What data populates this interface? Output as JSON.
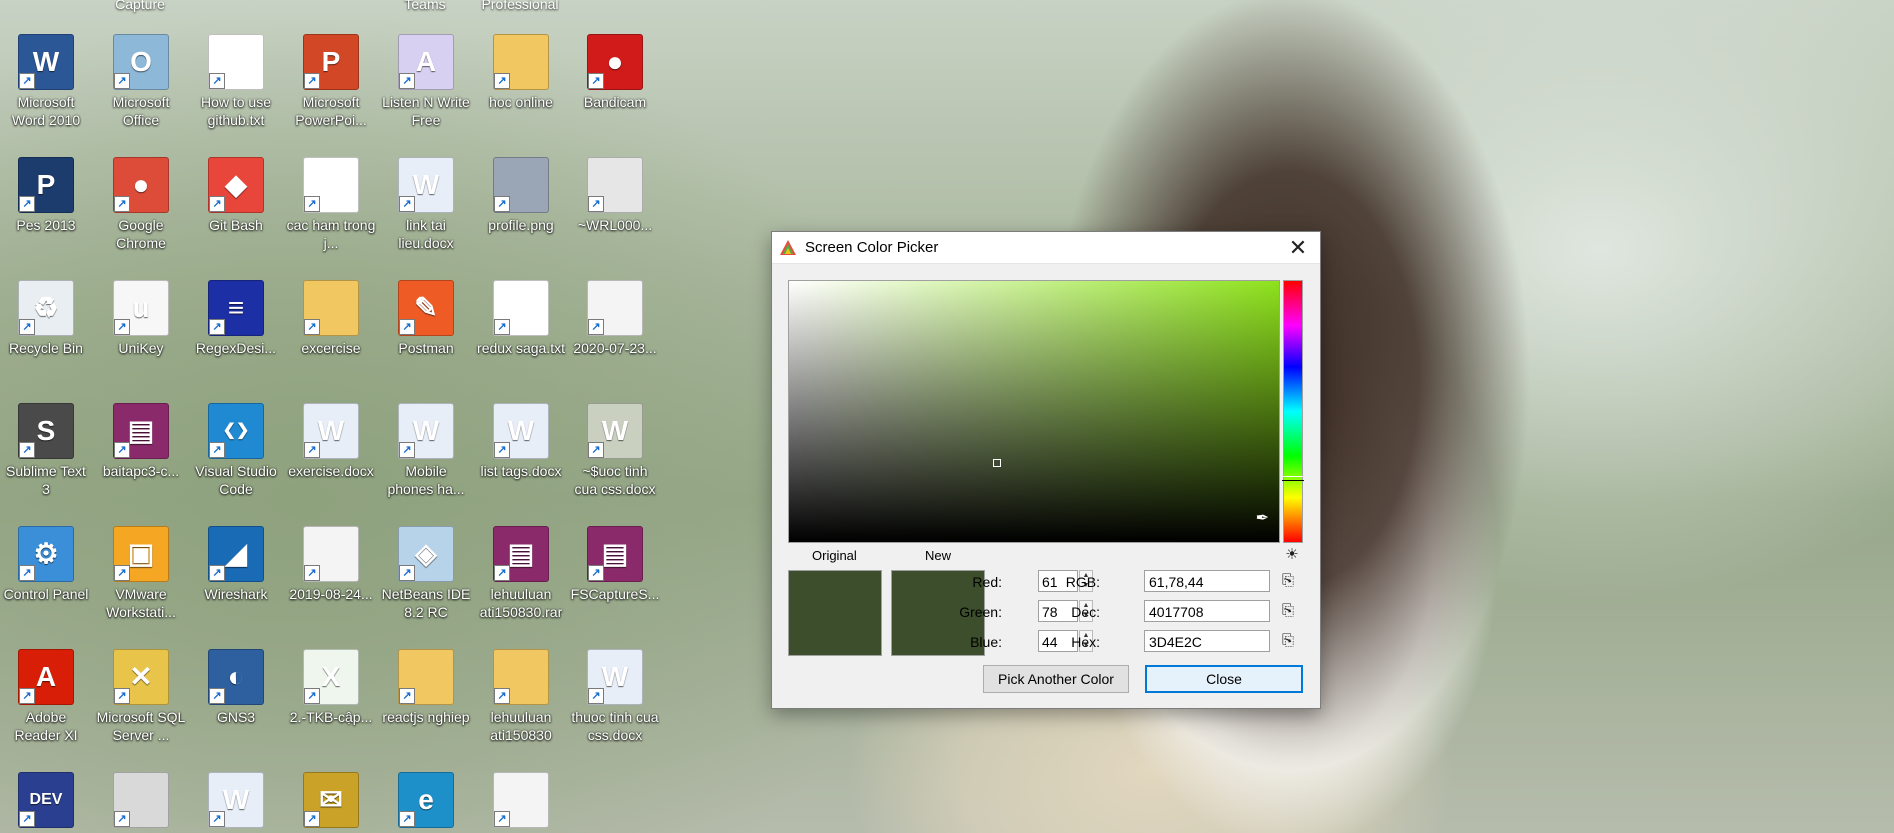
{
  "desktop": {
    "top_partial_labels": [
      "Capture",
      "Teams",
      "Professional"
    ],
    "icons": [
      {
        "label": "Microsoft Word 2010",
        "icon": "word-icon",
        "color": "#2b5797",
        "glyph": "W"
      },
      {
        "label": "Microsoft Office",
        "icon": "office-icon",
        "color": "#8db8d8",
        "glyph": "O"
      },
      {
        "label": "How to use github.txt",
        "icon": "text-file-icon",
        "color": "#ffffff",
        "glyph": ""
      },
      {
        "label": "Microsoft PowerPoi...",
        "icon": "powerpoint-icon",
        "color": "#d24726",
        "glyph": "P"
      },
      {
        "label": "Listen N Write Free",
        "icon": "listen-n-write-icon",
        "color": "#d8d0f0",
        "glyph": "A"
      },
      {
        "label": "hoc online",
        "icon": "folder-icon",
        "color": "#f1c761",
        "glyph": ""
      },
      {
        "label": "Bandicam",
        "icon": "bandicam-icon",
        "color": "#d11a1a",
        "glyph": "●"
      },
      {
        "label": "Pes 2013",
        "icon": "pes-icon",
        "color": "#1c3c6e",
        "glyph": "P"
      },
      {
        "label": "Google Chrome",
        "icon": "chrome-icon",
        "color": "#dd4b39",
        "glyph": "●"
      },
      {
        "label": "Git Bash",
        "icon": "git-bash-icon",
        "color": "#e8463b",
        "glyph": "◆"
      },
      {
        "label": "cac ham trong j...",
        "icon": "text-file-icon",
        "color": "#ffffff",
        "glyph": ""
      },
      {
        "label": "link tai lieu.docx",
        "icon": "word-doc-icon",
        "color": "#e8eef8",
        "glyph": "W"
      },
      {
        "label": "profile.png",
        "icon": "image-file-icon",
        "color": "#9aa6b6",
        "glyph": ""
      },
      {
        "label": "~WRL000...",
        "icon": "blank-file-icon",
        "color": "#e6e6e6",
        "glyph": ""
      },
      {
        "label": "Recycle Bin",
        "icon": "recycle-bin-icon",
        "color": "#e9eef3",
        "glyph": "♻"
      },
      {
        "label": "UniKey",
        "icon": "unikey-icon",
        "color": "#f7f7f7",
        "glyph": "u"
      },
      {
        "label": "RegexDesi...",
        "icon": "regex-designer-icon",
        "color": "#1d2fa4",
        "glyph": "≡"
      },
      {
        "label": "excercise",
        "icon": "folder-icon",
        "color": "#f1c761",
        "glyph": ""
      },
      {
        "label": "Postman",
        "icon": "postman-icon",
        "color": "#ef5b25",
        "glyph": "✎"
      },
      {
        "label": "redux saga.txt",
        "icon": "text-file-icon",
        "color": "#ffffff",
        "glyph": ""
      },
      {
        "label": "2020-07-23...",
        "icon": "document-image-icon",
        "color": "#f4f4f4",
        "glyph": ""
      },
      {
        "label": "Sublime Text 3",
        "icon": "sublime-icon",
        "color": "#4a4a4a",
        "glyph": "S"
      },
      {
        "label": "baitapc3-c...",
        "icon": "winrar-icon",
        "color": "#8b2a6b",
        "glyph": "▤"
      },
      {
        "label": "Visual Studio Code",
        "icon": "vscode-icon",
        "color": "#1f8ad2",
        "glyph": "❮❯"
      },
      {
        "label": "exercise.docx",
        "icon": "word-doc-icon",
        "color": "#e8eef8",
        "glyph": "W"
      },
      {
        "label": "Mobile phones ha...",
        "icon": "word-doc-icon",
        "color": "#e8eef8",
        "glyph": "W"
      },
      {
        "label": "list tags.docx",
        "icon": "word-doc-icon",
        "color": "#e8eef8",
        "glyph": "W"
      },
      {
        "label": "~$uoc tinh cua css.docx",
        "icon": "word-doc-icon",
        "color": "#c9d0c0",
        "glyph": "W"
      },
      {
        "label": "Control Panel",
        "icon": "control-panel-icon",
        "color": "#3a8fd8",
        "glyph": "⚙"
      },
      {
        "label": "VMware Workstati...",
        "icon": "vmware-icon",
        "color": "#f5a623",
        "glyph": "▣"
      },
      {
        "label": "Wireshark",
        "icon": "wireshark-icon",
        "color": "#1a6bb5",
        "glyph": "◢"
      },
      {
        "label": "2019-08-24...",
        "icon": "document-image-icon",
        "color": "#f4f4f4",
        "glyph": ""
      },
      {
        "label": "NetBeans IDE 8.2 RC",
        "icon": "netbeans-icon",
        "color": "#b6d3ea",
        "glyph": "◈"
      },
      {
        "label": "lehuuluan ati150830.rar",
        "icon": "winrar-icon",
        "color": "#8b2a6b",
        "glyph": "▤"
      },
      {
        "label": "FSCaptureS...",
        "icon": "winrar-icon",
        "color": "#8b2a6b",
        "glyph": "▤"
      },
      {
        "label": "Adobe Reader XI",
        "icon": "adobe-reader-icon",
        "color": "#d81e06",
        "glyph": "A"
      },
      {
        "label": "Microsoft SQL Server ...",
        "icon": "sql-server-icon",
        "color": "#e9c44b",
        "glyph": "✕"
      },
      {
        "label": "GNS3",
        "icon": "gns3-icon",
        "color": "#2e5f9f",
        "glyph": "◐"
      },
      {
        "label": "2.-TKB-cập...",
        "icon": "excel-file-icon",
        "color": "#eef6ee",
        "glyph": "X"
      },
      {
        "label": "reactjs nghiep",
        "icon": "folder-icon",
        "color": "#f1c761",
        "glyph": ""
      },
      {
        "label": "lehuuluan ati150830",
        "icon": "folder-icon",
        "color": "#f1c761",
        "glyph": ""
      },
      {
        "label": "thuoc tinh cua css.docx",
        "icon": "word-doc-icon",
        "color": "#e8eef8",
        "glyph": "W"
      },
      {
        "label": "",
        "icon": "dev-cpp-icon",
        "color": "#2a3f8f",
        "glyph": "DEV"
      },
      {
        "label": "",
        "icon": "generic-window-icon",
        "color": "#d9d9d9",
        "glyph": ""
      },
      {
        "label": "",
        "icon": "word-doc-icon",
        "color": "#e8eef8",
        "glyph": "W"
      },
      {
        "label": "",
        "icon": "mail-app-icon",
        "color": "#c9a227",
        "glyph": "✉"
      },
      {
        "label": "",
        "icon": "edge-icon",
        "color": "#1e90c9",
        "glyph": "e"
      },
      {
        "label": "",
        "icon": "document-image-icon",
        "color": "#f4f4f4",
        "glyph": ""
      }
    ]
  },
  "dialog": {
    "title": "Screen Color Picker",
    "close_glyph": "✕",
    "original_label": "Original",
    "new_label": "New",
    "original_color": "#3D4E2C",
    "new_color": "#3D4E2C",
    "base_hue_color": "#8ee21c",
    "red_label": "Red:",
    "red_value": "61",
    "green_label": "Green:",
    "green_value": "78",
    "blue_label": "Blue:",
    "blue_value": "44",
    "rgb_label": "RGB:",
    "rgb_value": "61,78,44",
    "dec_label": "Dec:",
    "dec_value": "4017708",
    "hex_label": "Hex:",
    "hex_value": "3D4E2C",
    "pick_button": "Pick Another Color",
    "close_button": "Close"
  }
}
